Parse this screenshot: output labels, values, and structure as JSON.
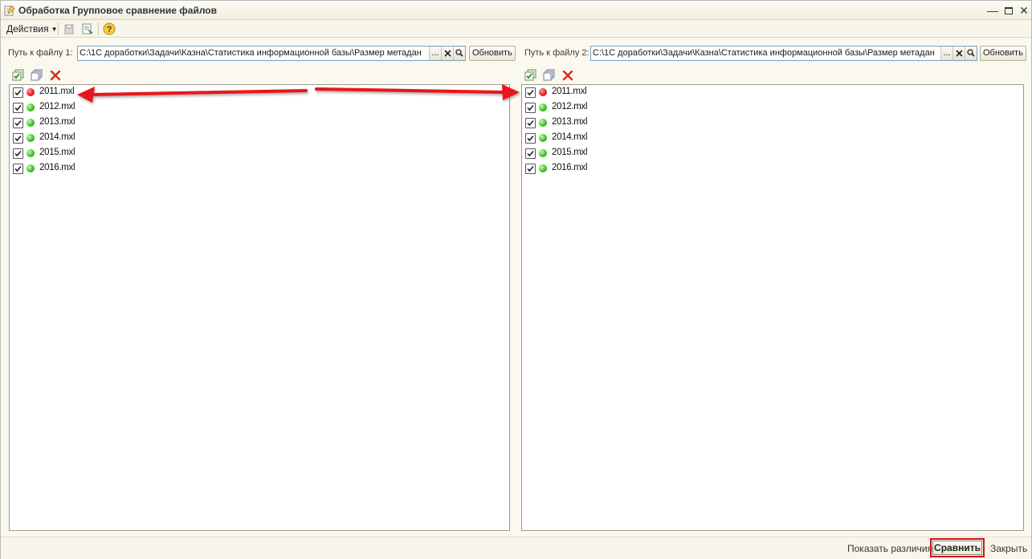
{
  "window": {
    "title": "Обработка  Групповое сравнение файлов",
    "minimize": "—",
    "close": "✕"
  },
  "toolbar": {
    "actions_label": "Действия"
  },
  "left": {
    "path_label": "Путь к файлу 1:",
    "path_value": "C:\\1C доработки\\Задачи\\Казна\\Статистика информационной базы\\Размер метадан",
    "select_btn": "...",
    "update_label": "Обновить",
    "files": [
      {
        "name": "2011.mxl",
        "checked": true,
        "status": "red"
      },
      {
        "name": "2012.mxl",
        "checked": true,
        "status": "green"
      },
      {
        "name": "2013.mxl",
        "checked": true,
        "status": "green"
      },
      {
        "name": "2014.mxl",
        "checked": true,
        "status": "green"
      },
      {
        "name": "2015.mxl",
        "checked": true,
        "status": "green"
      },
      {
        "name": "2016.mxl",
        "checked": true,
        "status": "green"
      }
    ]
  },
  "right": {
    "path_label": "Путь к файлу 2:",
    "path_value": "C:\\1C доработки\\Задачи\\Казна\\Статистика информационной базы\\Размер метадан",
    "select_btn": "...",
    "update_label": "Обновить",
    "files": [
      {
        "name": "2011.mxl",
        "checked": true,
        "status": "red"
      },
      {
        "name": "2012.mxl",
        "checked": true,
        "status": "green"
      },
      {
        "name": "2013.mxl",
        "checked": true,
        "status": "green"
      },
      {
        "name": "2014.mxl",
        "checked": true,
        "status": "green"
      },
      {
        "name": "2015.mxl",
        "checked": true,
        "status": "green"
      },
      {
        "name": "2016.mxl",
        "checked": true,
        "status": "green"
      }
    ]
  },
  "bottom": {
    "show_diff_label": "Показать различия",
    "compare_label": "Сравнить",
    "close_label": "Закрыть"
  },
  "colors": {
    "status_red": "#e52222",
    "status_green": "#37c81e",
    "annotation_red": "#e8151b",
    "window_bg": "#fbf9ef"
  }
}
